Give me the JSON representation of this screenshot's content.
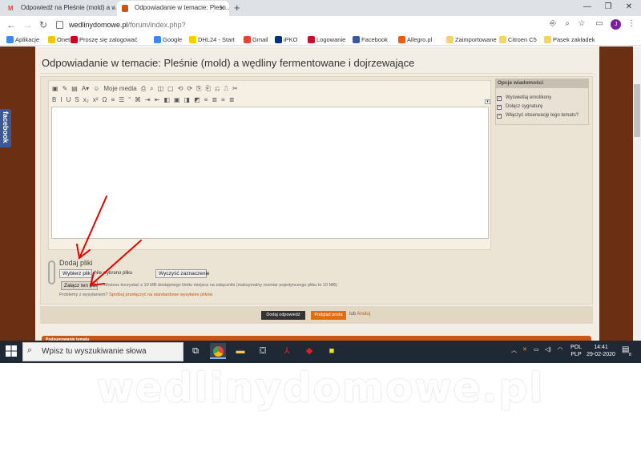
{
  "tabs": [
    {
      "label": "Odpowiedź na Pleśnie (mold) a w...",
      "icon": "gmail-icon",
      "active": false
    },
    {
      "label": "Odpowiadanie w temacie: Pleśn...",
      "icon": "forum-favicon",
      "active": true
    }
  ],
  "address_bar": {
    "host": "wedlinydomowe.pl",
    "path": "/forum/index.php?"
  },
  "profile_initial": "J",
  "bookmarks": [
    {
      "label": "Aplikacje",
      "color": "#4285f4"
    },
    {
      "label": "Onet",
      "color": "#f6c400"
    },
    {
      "label": "Proszę się zalogować",
      "color": "#d0021b"
    },
    {
      "label": "Google",
      "color": "#4285f4"
    },
    {
      "label": "DHL24 - Start",
      "color": "#ffcc00"
    },
    {
      "label": "Gmail",
      "color": "#ea4335"
    },
    {
      "label": "iPKO",
      "color": "#003574"
    },
    {
      "label": "Logowanie",
      "color": "#c8102e"
    },
    {
      "label": "Facebook",
      "color": "#3b5998"
    },
    {
      "label": "Allegro.pl",
      "color": "#ff5a00"
    },
    {
      "label": "Zaimportowane",
      "color": "#f5d36b"
    },
    {
      "label": "Citroen C5",
      "color": "#f5d36b"
    },
    {
      "label": "Pasek zakładek",
      "color": "#f5d36b"
    }
  ],
  "page": {
    "title": "Odpowiadanie w temacie: Pleśnie (mold) a wędliny fermentowane i dojrzewające",
    "editor_toolbar_row1": [
      "▣",
      "✎",
      "▤",
      "A▾",
      "☺",
      "Moje media",
      "⎙",
      "⌕",
      "◫",
      "▢",
      "⟲",
      "⟳",
      "⎘",
      "⎗",
      "⎌",
      "⎍",
      "✂"
    ],
    "editor_toolbar_row2": [
      "B",
      "I",
      "U",
      "S",
      "x₂",
      "x²",
      "Ω",
      "≡",
      "☰",
      "“",
      "⌘",
      "⇥",
      "⇤",
      "◧",
      "▣",
      "◨",
      "◩",
      "≡",
      "≣",
      "≡",
      "≣"
    ],
    "options": {
      "heading": "Opcje wiadomości",
      "items": [
        "Wyświetlaj emotikony",
        "Dołącz sygnaturę",
        "Włączyć obserwację tego tematu?"
      ]
    },
    "attachments": {
      "heading": "Dodaj pliki",
      "choose_button": "Wybierz plik",
      "no_file": "Nie wybrano pliku",
      "clear_button": "Wyczyść zaznaczenie",
      "attach_button": "Załącz ten plik",
      "limit_text": "Możesz korzystać z 10 MB dostępnego limitu miejsca na załączniki (maksymalny rozmiar pojedynczego pliku to 10 MB)",
      "problems_text": "Problemy z wysyłaniem?",
      "problems_link": "Spróbuj przełączyć na standardowe wysyłanie plików"
    },
    "submit_button": "Dodaj odpowiedź",
    "preview_button": "Podgląd posta",
    "or_text": "lub",
    "cancel_link": "Anuluj",
    "section_bar": "Podsumowanie tematu",
    "facebook_tab": "facebook"
  },
  "taskbar": {
    "search_placeholder": "Wpisz tu wyszukiwanie słowa",
    "lang_top": "POL",
    "lang_bottom": "PLP",
    "time": "14:41",
    "date": "29-02-2020",
    "notification_count": "8"
  },
  "watermark": "wedlinydomowe.pl",
  "colors": {
    "accent_orange": "#e36b12",
    "page_brown": "#6b2f14",
    "taskbar": "#1f2935",
    "annotation_red": "#e00000"
  }
}
